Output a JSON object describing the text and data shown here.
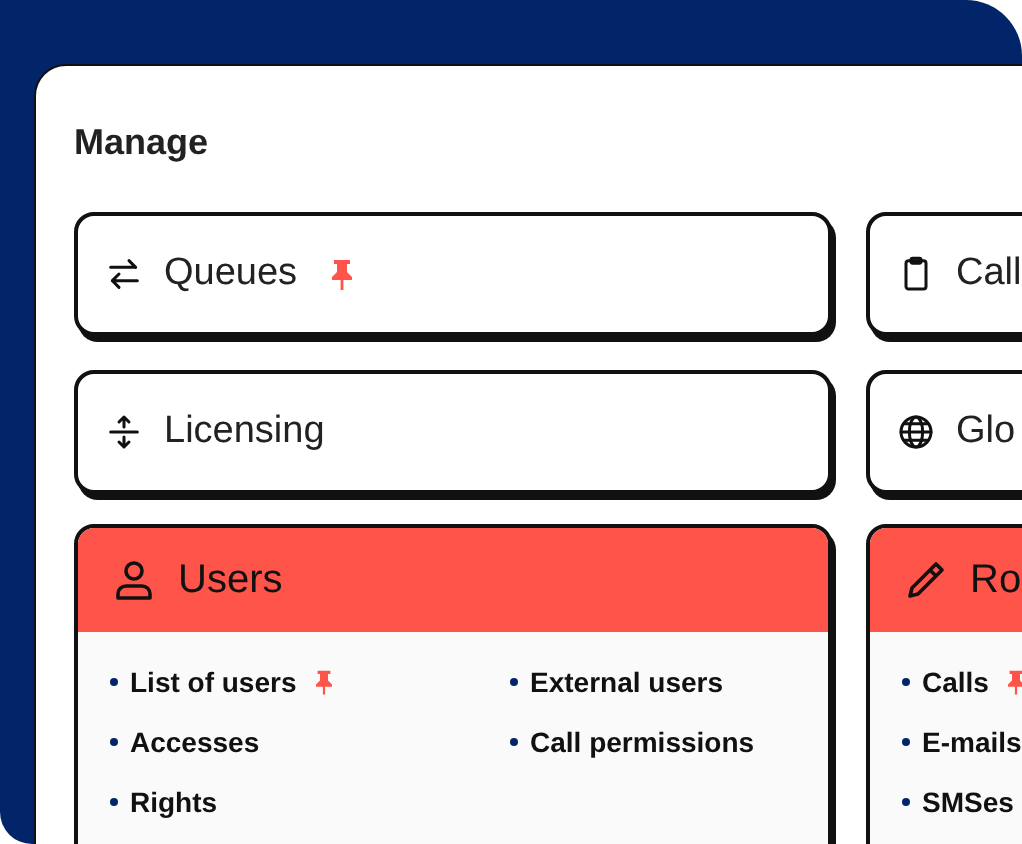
{
  "title": "Manage",
  "tiles": [
    {
      "label": "Queues",
      "pinned": true
    },
    {
      "label": "Call",
      "pinned": false
    },
    {
      "label": "Licensing",
      "pinned": false
    },
    {
      "label": "Glo",
      "pinned": false
    }
  ],
  "sections": [
    {
      "title": "Users",
      "items": [
        {
          "label": "List of users",
          "pinned": true
        },
        {
          "label": "Accesses",
          "pinned": false
        },
        {
          "label": "Rights",
          "pinned": false
        },
        {
          "label": "External users",
          "pinned": false
        },
        {
          "label": "Call permissions",
          "pinned": false
        }
      ]
    },
    {
      "title": "Ro",
      "items": [
        {
          "label": "Calls",
          "pinned": true
        },
        {
          "label": "E-mails",
          "pinned": false
        },
        {
          "label": "SMSes",
          "pinned": false
        }
      ]
    }
  ]
}
